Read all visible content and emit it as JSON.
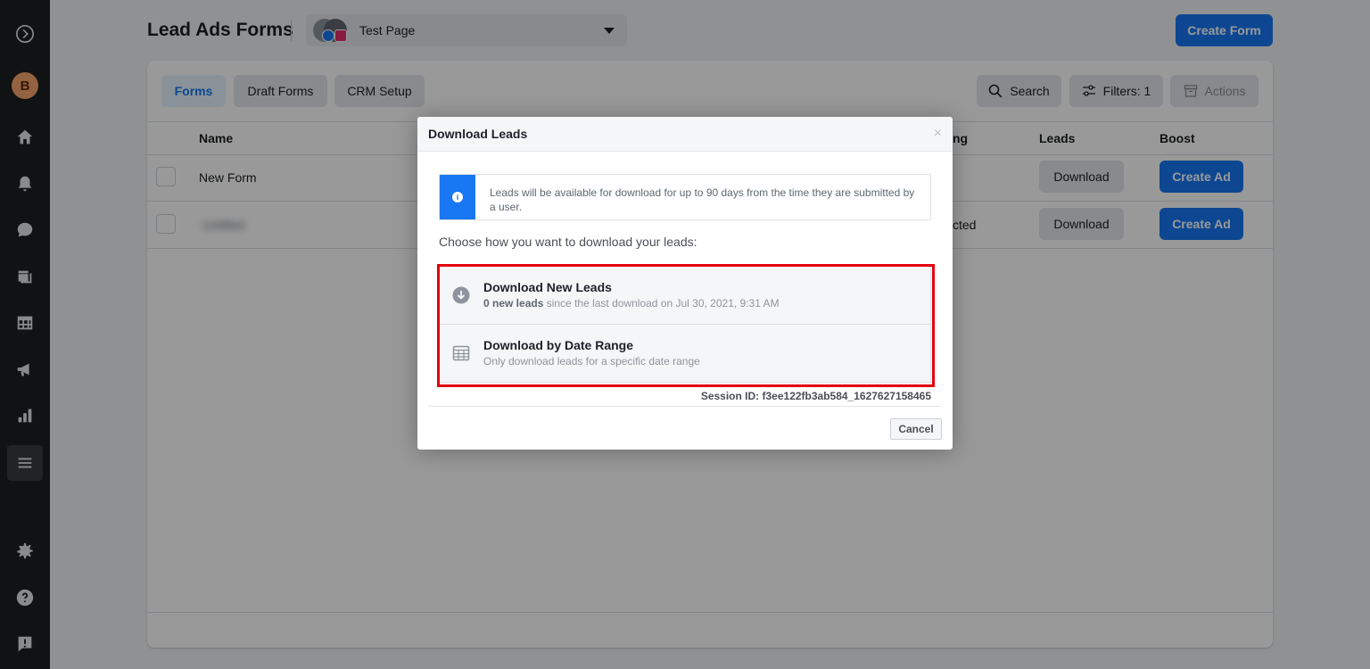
{
  "header": {
    "title": "Lead Ads Forms",
    "page_selector": {
      "selected": "Test Page"
    },
    "create_form_label": "Create Form"
  },
  "rail": {
    "avatar_letter": "B",
    "icons": [
      "logo-icon",
      "home-icon",
      "bell-icon",
      "chat-icon",
      "pages-icon",
      "table-icon",
      "megaphone-icon",
      "bar-chart-icon",
      "menu-icon",
      "gear-icon",
      "help-icon",
      "report-icon"
    ]
  },
  "tabs": [
    {
      "label": "Forms",
      "active": true
    },
    {
      "label": "Draft Forms",
      "active": false
    },
    {
      "label": "CRM Setup",
      "active": false
    }
  ],
  "toolbar": {
    "search_label": "Search",
    "filters_label": "Filters: 1",
    "actions_label": "Actions"
  },
  "table": {
    "columns": {
      "name": "Name",
      "tracking_fragment": "ng",
      "leads": "Leads",
      "boost": "Boost"
    },
    "rows": [
      {
        "name": "New Form",
        "tracking": "",
        "download_label": "Download",
        "boost_label": "Create Ad"
      },
      {
        "name": "Untitled",
        "tracking": "cted",
        "download_label": "Download",
        "boost_label": "Create Ad"
      }
    ]
  },
  "modal": {
    "title": "Download Leads",
    "close_symbol": "×",
    "info_text": "Leads will be available for download for up to 90 days from the time they are submitted by a user.",
    "choose_text": "Choose how you want to download your leads:",
    "option_new": {
      "title": "Download New Leads",
      "count_bold": "0 new leads",
      "subtitle_rest": "since the last download on Jul 30, 2021, 9:31 AM"
    },
    "option_range": {
      "title": "Download by Date Range",
      "subtitle": "Only download leads for a specific date range"
    },
    "session_id": "Session ID: f3ee122fb3ab584_1627627158465",
    "cancel_label": "Cancel"
  },
  "colors": {
    "brand_blue": "#1877f2",
    "highlight_red": "#e3000f",
    "rail_bg": "#1c1e21"
  }
}
